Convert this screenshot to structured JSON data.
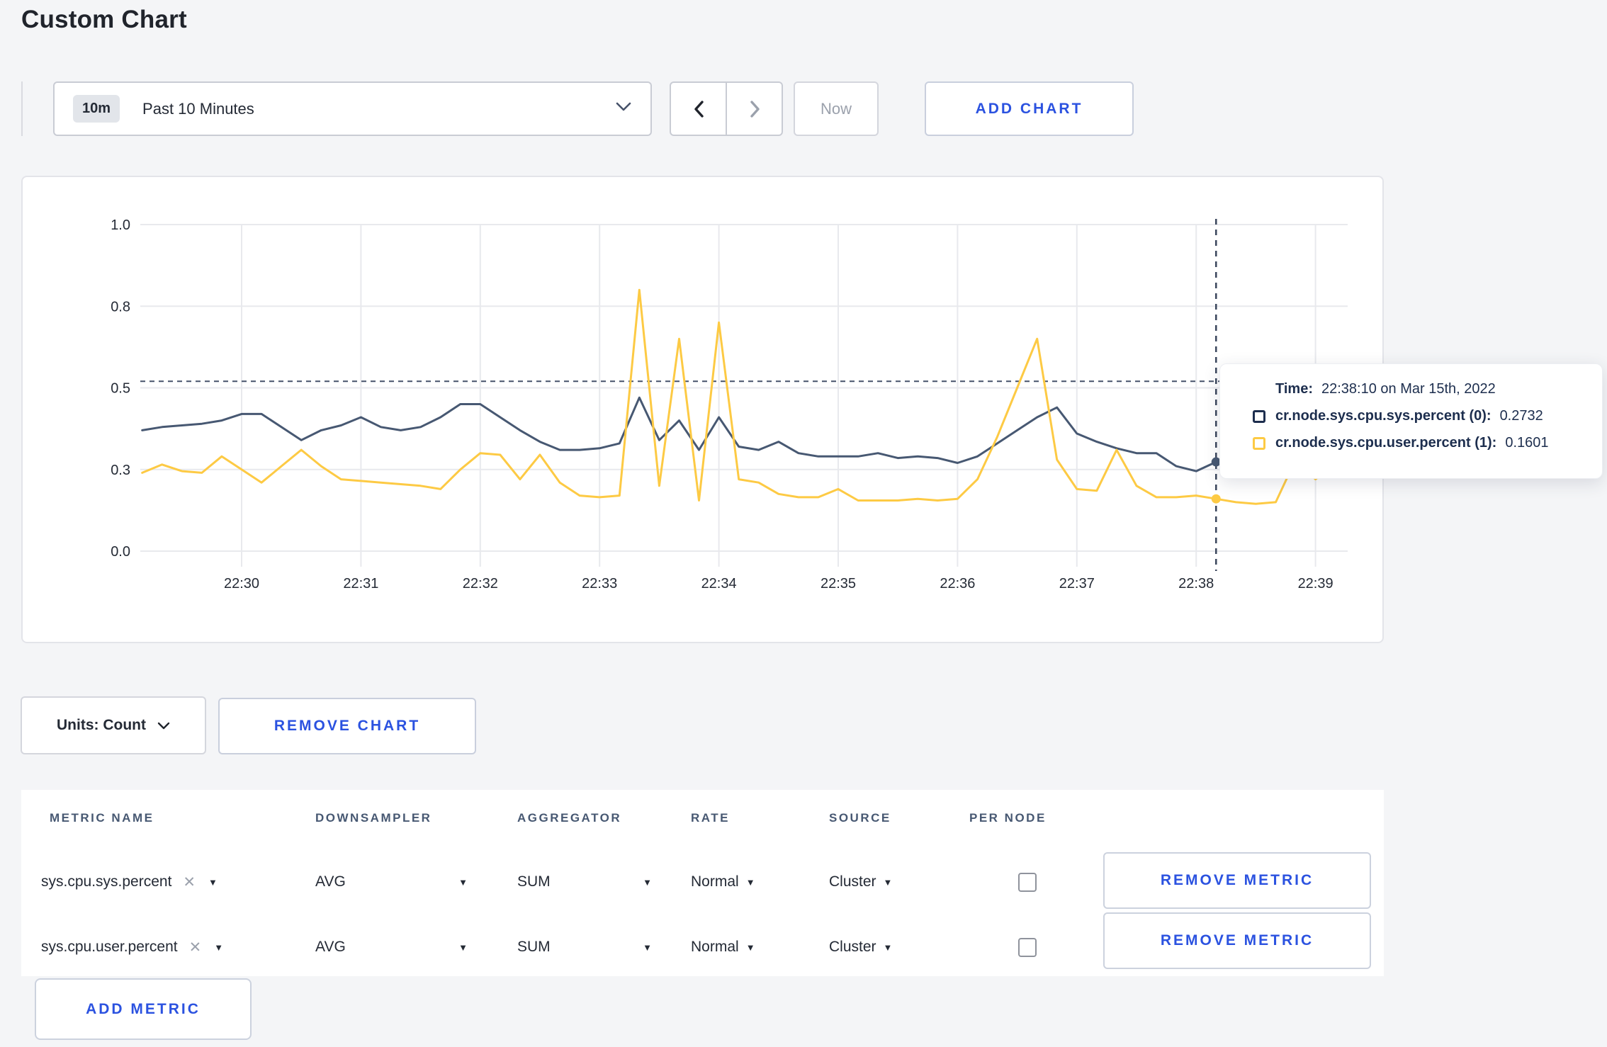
{
  "page": {
    "title": "Custom Chart"
  },
  "toolbar": {
    "time_window_badge": "10m",
    "time_window_label": "Past 10 Minutes",
    "now_label": "Now",
    "add_chart_label": "ADD CHART"
  },
  "chart_data": {
    "type": "line",
    "x_start": "22:29:10",
    "x_interval_seconds": 10,
    "x_tick_labels": [
      "22:30",
      "22:31",
      "22:32",
      "22:33",
      "22:34",
      "22:35",
      "22:36",
      "22:37",
      "22:38",
      "22:39"
    ],
    "y_tick_labels": [
      "1.0",
      "0.8",
      "0.5",
      "0.3",
      "0.0"
    ],
    "y_tick_values": [
      1.0,
      0.75,
      0.5,
      0.25,
      0.0
    ],
    "ylim": [
      0,
      1.0
    ],
    "grid": true,
    "series": [
      {
        "name": "cr.node.sys.cpu.sys.percent",
        "color": "#475872",
        "values": [
          0.37,
          0.38,
          0.385,
          0.39,
          0.4,
          0.42,
          0.42,
          0.38,
          0.34,
          0.37,
          0.385,
          0.41,
          0.38,
          0.37,
          0.38,
          0.41,
          0.45,
          0.45,
          0.41,
          0.37,
          0.335,
          0.31,
          0.31,
          0.315,
          0.33,
          0.47,
          0.34,
          0.4,
          0.31,
          0.41,
          0.32,
          0.31,
          0.335,
          0.3,
          0.29,
          0.29,
          0.29,
          0.3,
          0.285,
          0.29,
          0.285,
          0.27,
          0.29,
          0.33,
          0.37,
          0.41,
          0.44,
          0.36,
          0.335,
          0.315,
          0.3,
          0.3,
          0.26,
          0.245,
          0.2732,
          0.26,
          0.27,
          0.28,
          0.3,
          0.31,
          0.3
        ]
      },
      {
        "name": "cr.node.sys.cpu.user.percent",
        "color": "#fdca44",
        "values": [
          0.24,
          0.265,
          0.245,
          0.24,
          0.29,
          0.25,
          0.21,
          0.26,
          0.31,
          0.26,
          0.22,
          0.215,
          0.21,
          0.205,
          0.2,
          0.19,
          0.25,
          0.3,
          0.295,
          0.22,
          0.295,
          0.21,
          0.17,
          0.165,
          0.17,
          0.8,
          0.2,
          0.65,
          0.155,
          0.7,
          0.22,
          0.21,
          0.175,
          0.165,
          0.165,
          0.19,
          0.155,
          0.155,
          0.155,
          0.16,
          0.155,
          0.16,
          0.22,
          0.35,
          0.5,
          0.65,
          0.28,
          0.19,
          0.185,
          0.31,
          0.2,
          0.165,
          0.165,
          0.17,
          0.1601,
          0.15,
          0.145,
          0.15,
          0.28,
          0.22,
          0.27
        ]
      }
    ],
    "hover": {
      "index": 54,
      "time": "22:38:10",
      "crosshair_y_value": 0.52,
      "sys_value": 0.2732,
      "user_value": 0.1601
    }
  },
  "tooltip": {
    "time_label": "Time:",
    "time_value": "22:38:10 on Mar 15th, 2022",
    "rows": [
      {
        "label": "cr.node.sys.cpu.sys.percent (0):",
        "value": "0.2732",
        "color": "#1d2e4e"
      },
      {
        "label": "cr.node.sys.cpu.user.percent (1):",
        "value": "0.1601",
        "color": "#fdca44"
      }
    ]
  },
  "units_bar": {
    "units_label": "Units: Count",
    "remove_chart_label": "REMOVE CHART"
  },
  "metrics_table": {
    "headers": {
      "metric_name": "METRIC NAME",
      "downsampler": "DOWNSAMPLER",
      "aggregator": "AGGREGATOR",
      "rate": "RATE",
      "source": "SOURCE",
      "per_node": "PER NODE"
    },
    "remove_icon": "✕",
    "rows": [
      {
        "metric": "sys.cpu.sys.percent",
        "downsampler": "AVG",
        "aggregator": "SUM",
        "rate": "Normal",
        "source": "Cluster",
        "per_node": false,
        "remove_label": "REMOVE METRIC"
      },
      {
        "metric": "sys.cpu.user.percent",
        "downsampler": "AVG",
        "aggregator": "SUM",
        "rate": "Normal",
        "source": "Cluster",
        "per_node": false,
        "remove_label": "REMOVE METRIC"
      }
    ],
    "add_metric_label": "ADD METRIC"
  }
}
